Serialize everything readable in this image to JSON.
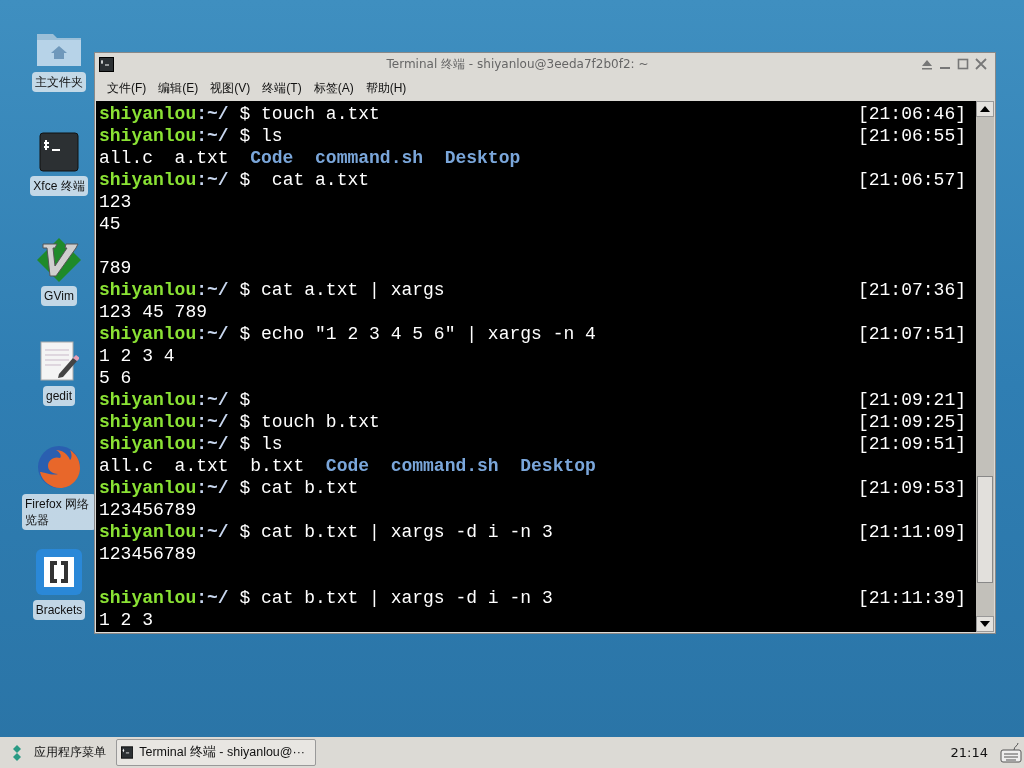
{
  "desktop_icons": [
    {
      "label": "主文件夹",
      "kind": "folder"
    },
    {
      "label": "Xfce 终端",
      "kind": "terminal"
    },
    {
      "label": "GVim",
      "kind": "vim"
    },
    {
      "label": "gedit",
      "kind": "editor"
    },
    {
      "label": "Firefox 网络览器",
      "kind": "browser"
    },
    {
      "label": "Brackets",
      "kind": "brackets"
    }
  ],
  "window": {
    "title": "Terminal 终端 - shiyanlou@3eeda7f2b0f2: ~",
    "menu": [
      {
        "label": "文件(F)"
      },
      {
        "label": "编辑(E)"
      },
      {
        "label": "视图(V)"
      },
      {
        "label": "终端(T)"
      },
      {
        "label": "标签(A)"
      },
      {
        "label": "帮助(H)"
      }
    ]
  },
  "terminal": {
    "lines": [
      {
        "kind": "prompt",
        "user": "shiyanlou",
        "path": ":~/",
        "symbol": "$",
        "command": "touch a.txt",
        "time": "[21:06:46]"
      },
      {
        "kind": "prompt",
        "user": "shiyanlou",
        "path": ":~/",
        "symbol": "$",
        "command": "ls",
        "time": "[21:06:55]"
      },
      {
        "kind": "listing",
        "items": [
          {
            "name": "all.c",
            "kind": "file"
          },
          {
            "name": "a.txt",
            "kind": "file"
          },
          {
            "name": "Code",
            "kind": "dir"
          },
          {
            "name": "command.sh",
            "kind": "dir"
          },
          {
            "name": "Desktop",
            "kind": "dir"
          }
        ]
      },
      {
        "kind": "prompt",
        "user": "shiyanlou",
        "path": ":~/",
        "symbol": "$",
        "command": " cat a.txt",
        "time": "[21:06:57]"
      },
      {
        "kind": "output",
        "text": "123"
      },
      {
        "kind": "output",
        "text": "45"
      },
      {
        "kind": "blank"
      },
      {
        "kind": "output",
        "text": "789"
      },
      {
        "kind": "prompt",
        "user": "shiyanlou",
        "path": ":~/",
        "symbol": "$",
        "command": "cat a.txt | xargs",
        "time": "[21:07:36]"
      },
      {
        "kind": "output",
        "text": "123 45 789"
      },
      {
        "kind": "prompt",
        "user": "shiyanlou",
        "path": ":~/",
        "symbol": "$",
        "command": "echo \"1 2 3 4 5 6\" | xargs -n 4",
        "time": "[21:07:51]"
      },
      {
        "kind": "output",
        "text": "1 2 3 4"
      },
      {
        "kind": "output",
        "text": "5 6"
      },
      {
        "kind": "prompt",
        "user": "shiyanlou",
        "path": ":~/",
        "symbol": "$",
        "time": "[21:09:21]"
      },
      {
        "kind": "prompt",
        "user": "shiyanlou",
        "path": ":~/",
        "symbol": "$",
        "command": "touch b.txt",
        "time": "[21:09:25]"
      },
      {
        "kind": "prompt",
        "user": "shiyanlou",
        "path": ":~/",
        "symbol": "$",
        "command": "ls",
        "time": "[21:09:51]"
      },
      {
        "kind": "listing",
        "items": [
          {
            "name": "all.c",
            "kind": "file"
          },
          {
            "name": "a.txt",
            "kind": "file"
          },
          {
            "name": "b.txt",
            "kind": "file"
          },
          {
            "name": "Code",
            "kind": "dir"
          },
          {
            "name": "command.sh",
            "kind": "dir"
          },
          {
            "name": "Desktop",
            "kind": "dir"
          }
        ]
      },
      {
        "kind": "prompt",
        "user": "shiyanlou",
        "path": ":~/",
        "symbol": "$",
        "command": "cat b.txt",
        "time": "[21:09:53]"
      },
      {
        "kind": "output",
        "text": "123456789"
      },
      {
        "kind": "prompt",
        "user": "shiyanlou",
        "path": ":~/",
        "symbol": "$",
        "command": "cat b.txt | xargs -d i -n 3",
        "time": "[21:11:09]"
      },
      {
        "kind": "output",
        "text": "123456789"
      },
      {
        "kind": "blank"
      },
      {
        "kind": "prompt",
        "user": "shiyanlou",
        "path": ":~/",
        "symbol": "$",
        "command": "cat b.txt | xargs -d i -n 3",
        "time": "[21:11:39]"
      },
      {
        "kind": "output",
        "text": "1 2 3"
      }
    ]
  },
  "taskbar": {
    "app_menu": "应用程序菜单",
    "task": "Terminal 终端 - shiyanlou@···",
    "clock": "21:14"
  }
}
